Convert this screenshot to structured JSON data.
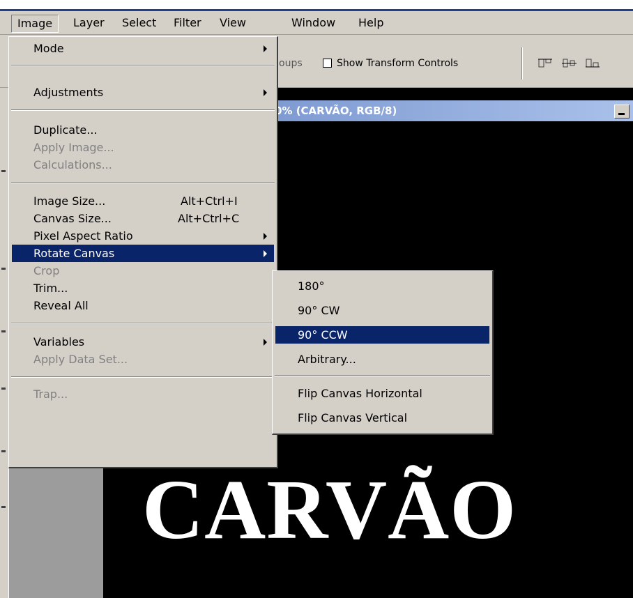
{
  "menubar": {
    "items": [
      "Image",
      "Layer",
      "Select",
      "Filter",
      "View",
      "Window",
      "Help"
    ]
  },
  "options_bar": {
    "partial_label": "oups",
    "show_transform_controls": "Show Transform Controls",
    "show_transform_checked": false
  },
  "document": {
    "title": "0% (CARVÃO, RGB/8)",
    "canvas_text": "CARVÃO"
  },
  "image_menu": {
    "mode": "Mode",
    "adjustments": "Adjustments",
    "duplicate": "Duplicate...",
    "apply_image": "Apply Image...",
    "calculations": "Calculations...",
    "image_size": "Image Size...",
    "image_size_shortcut": "Alt+Ctrl+I",
    "canvas_size": "Canvas Size...",
    "canvas_size_shortcut": "Alt+Ctrl+C",
    "pixel_aspect_ratio": "Pixel Aspect Ratio",
    "rotate_canvas": "Rotate Canvas",
    "crop": "Crop",
    "trim": "Trim...",
    "reveal_all": "Reveal All",
    "variables": "Variables",
    "apply_data_set": "Apply Data Set...",
    "trap": "Trap..."
  },
  "rotate_submenu": {
    "r180": "180°",
    "r90cw": "90° CW",
    "r90ccw": "90° CCW",
    "arbitrary": "Arbitrary...",
    "flip_h": "Flip Canvas Horizontal",
    "flip_v": "Flip Canvas Vertical"
  },
  "colors": {
    "menu_bg": "#d4d0c8",
    "highlight": "#0a246a",
    "title_gradient_start": "#6b88c6"
  }
}
